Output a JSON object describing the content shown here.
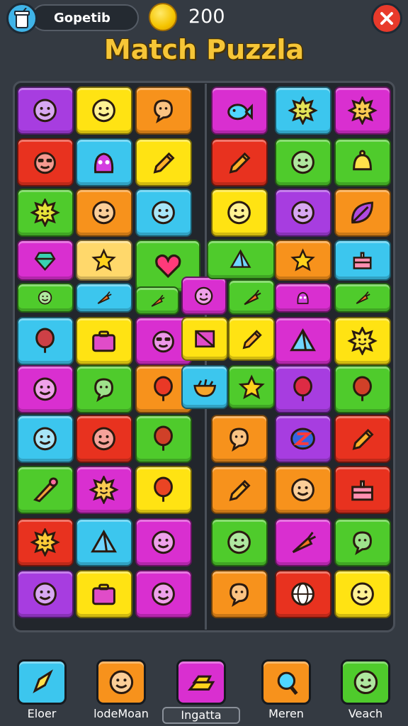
{
  "header": {
    "username": "Gopetib",
    "coins": "200",
    "title": "Match Puzzla"
  },
  "colors": {
    "purple": "#a73de0",
    "yellow": "#ffe313",
    "orange": "#f7921c",
    "cyan": "#3cc6ee",
    "red": "#e8321f",
    "green": "#4fcb2c",
    "magenta": "#d92fd0",
    "peach": "#ffd86b"
  },
  "board": {
    "left_tiles": [
      {
        "color": "purple",
        "icon": "smiley-face-icon"
      },
      {
        "color": "yellow",
        "icon": "smiley-face-icon"
      },
      {
        "color": "orange",
        "icon": "speech-bubble-icon"
      },
      {
        "color": "red",
        "icon": "sunglasses-face-icon"
      },
      {
        "color": "cyan",
        "icon": "creature-icon"
      },
      {
        "color": "yellow",
        "icon": "pencil-icon"
      },
      {
        "color": "green",
        "icon": "sun-face-icon"
      },
      {
        "color": "orange",
        "icon": "smiley-face-icon"
      },
      {
        "color": "cyan",
        "icon": "smiley-face-icon"
      },
      {
        "color": "magenta",
        "icon": "gem-icon"
      },
      {
        "color": "peach",
        "icon": "star-icon"
      },
      {
        "color": "green",
        "icon": "smiley-face-icon"
      },
      {
        "color": "cyan",
        "icon": "carrot-icon"
      },
      {
        "color": "cyan",
        "icon": "balloon-icon"
      },
      {
        "color": "yellow",
        "icon": "briefcase-icon"
      },
      {
        "color": "magenta",
        "icon": "sunglasses-face-icon"
      },
      {
        "color": "magenta",
        "icon": "smiley-face-icon"
      },
      {
        "color": "green",
        "icon": "speech-bubble-icon"
      },
      {
        "color": "orange",
        "icon": "balloon-icon"
      },
      {
        "color": "cyan",
        "icon": "smiley-face-icon"
      },
      {
        "color": "red",
        "icon": "smiley-face-icon"
      },
      {
        "color": "green",
        "icon": "balloon-icon"
      },
      {
        "color": "green",
        "icon": "ice-cream-icon"
      },
      {
        "color": "magenta",
        "icon": "sun-face-icon"
      },
      {
        "color": "yellow",
        "icon": "balloon-icon"
      },
      {
        "color": "red",
        "icon": "sun-face-icon"
      },
      {
        "color": "cyan",
        "icon": "triangle-icon"
      },
      {
        "color": "magenta",
        "icon": "smiley-face-icon"
      },
      {
        "color": "purple",
        "icon": "smiley-face-icon"
      },
      {
        "color": "yellow",
        "icon": "briefcase-icon"
      },
      {
        "color": "magenta",
        "icon": "smiley-face-icon"
      }
    ],
    "center_tiles": [
      {
        "color": "green",
        "icon": "heart-icon"
      },
      {
        "color": "green",
        "icon": "carrot-icon"
      },
      {
        "color": "magenta",
        "icon": "smiley-face-icon"
      },
      {
        "color": "yellow",
        "icon": "box-icon"
      },
      {
        "color": "cyan",
        "icon": "bowl-icon"
      },
      {
        "color": "green",
        "icon": "star-icon"
      },
      {
        "color": "green",
        "icon": "pyramid-icon"
      },
      {
        "color": "green",
        "icon": "carrot-icon"
      },
      {
        "color": "yellow",
        "icon": "pencil-icon"
      }
    ],
    "right_tiles": [
      {
        "color": "magenta",
        "icon": "fish-icon"
      },
      {
        "color": "cyan",
        "icon": "sun-face-icon"
      },
      {
        "color": "magenta",
        "icon": "sun-face-icon"
      },
      {
        "color": "red",
        "icon": "pencil-icon"
      },
      {
        "color": "green",
        "icon": "smiley-face-icon"
      },
      {
        "color": "green",
        "icon": "bell-icon"
      },
      {
        "color": "yellow",
        "icon": "smiley-face-icon"
      },
      {
        "color": "purple",
        "icon": "smiley-face-icon"
      },
      {
        "color": "orange",
        "icon": "leaf-icon"
      },
      {
        "color": "orange",
        "icon": "star-icon"
      },
      {
        "color": "cyan",
        "icon": "cake-icon"
      },
      {
        "color": "magenta",
        "icon": "creature-icon"
      },
      {
        "color": "green",
        "icon": "carrot-icon"
      },
      {
        "color": "magenta",
        "icon": "pyramid-icon"
      },
      {
        "color": "yellow",
        "icon": "sun-face-icon"
      },
      {
        "color": "purple",
        "icon": "balloon-icon"
      },
      {
        "color": "green",
        "icon": "balloon-icon"
      },
      {
        "color": "orange",
        "icon": "speech-bubble-icon"
      },
      {
        "color": "purple",
        "icon": "letter-z-icon"
      },
      {
        "color": "red",
        "icon": "pencil-icon"
      },
      {
        "color": "orange",
        "icon": "pencil-icon"
      },
      {
        "color": "orange",
        "icon": "smiley-face-icon"
      },
      {
        "color": "red",
        "icon": "cake-icon"
      },
      {
        "color": "green",
        "icon": "smiley-face-icon"
      },
      {
        "color": "magenta",
        "icon": "carrot-icon"
      },
      {
        "color": "green",
        "icon": "speech-bubble-icon"
      },
      {
        "color": "orange",
        "icon": "speech-bubble-icon"
      },
      {
        "color": "red",
        "icon": "globe-icon"
      },
      {
        "color": "yellow",
        "icon": "smiley-face-icon"
      }
    ]
  },
  "bottom_bar": [
    {
      "label": "Eloer",
      "color": "cyan",
      "icon": "rocket-icon"
    },
    {
      "label": "lodeMoan",
      "color": "orange",
      "icon": "smiley-face-icon"
    },
    {
      "label": "Ingatta",
      "color": "magenta",
      "icon": "gold-bars-icon"
    },
    {
      "label": "Meren",
      "color": "orange",
      "icon": "magnifier-icon"
    },
    {
      "label": "Veach",
      "color": "green",
      "icon": "smiley-face-icon"
    }
  ]
}
